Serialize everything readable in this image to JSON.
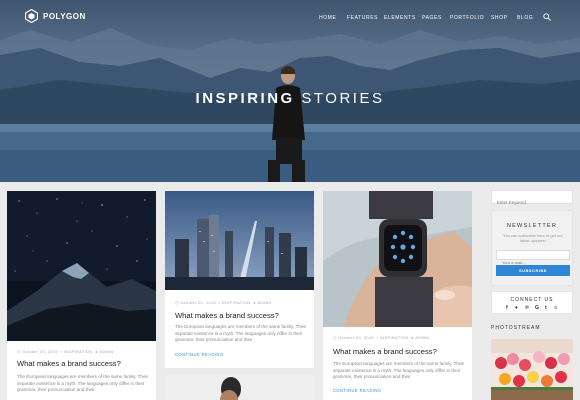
{
  "site": {
    "logo_text": "POLYGON"
  },
  "nav": {
    "items": [
      {
        "label": "HOME",
        "name": "nav-home"
      },
      {
        "label": "FEATURES",
        "name": "nav-features"
      },
      {
        "label": "ELEMENTS",
        "name": "nav-elements"
      },
      {
        "label": "PAGES",
        "name": "nav-pages"
      },
      {
        "label": "PORTFOLIO",
        "name": "nav-portfolio"
      },
      {
        "label": "SHOP",
        "name": "nav-shop"
      },
      {
        "label": "BLOG",
        "name": "nav-blog"
      }
    ],
    "search_icon": "search-icon"
  },
  "hero": {
    "title_bold": "INSPIRING",
    "title_rest": " STORIES"
  },
  "posts": [
    {
      "date": "October 20, 2015",
      "category": "INSPIRATION",
      "author": "ADMIN",
      "title": "What makes a brand success?",
      "excerpt": "The European languages are members of the same family. Their separate existence is a myth. The languages only differ in their grammar, their pronunciation and their",
      "read_more": ""
    },
    {
      "date": "October 20, 2015",
      "category": "INSPIRATION",
      "author": "ADMIN",
      "title": "What makes a brand success?",
      "excerpt": "The European languages are members of the same family. Their separate existence is a myth. The languages only differ in their grammar, their pronunciation and their",
      "read_more": "CONTINUE READING"
    },
    {
      "date": "October 20, 2015",
      "category": "INSPIRATION",
      "author": "ADMIN",
      "title": "What makes a brand success?",
      "excerpt": "The European languages are members of the same family. Their separate existence is a myth. The languages only differ in their grammar, their pronunciation and their",
      "read_more": "CONTINUE READING"
    }
  ],
  "sidebar": {
    "search_placeholder": "Enter Keyword",
    "newsletter": {
      "title": "NEWSLETTER",
      "text": "You can subscribe here to get our latest updates!",
      "email_placeholder": "Your e-mail...",
      "button": "SUBSCRIBE"
    },
    "connect": {
      "title": "CONNECT US",
      "icons": [
        "facebook-icon",
        "twitter-icon",
        "pinterest-icon",
        "google-plus-icon",
        "tumblr-icon",
        "rss-icon"
      ],
      "glyphs": [
        "f",
        "♦",
        "℗",
        "G",
        "t",
        "≡"
      ]
    },
    "photostream": {
      "title": "PHOTOSTREAM"
    }
  },
  "colors": {
    "accent": "#2f86d6",
    "link": "#3b8fd6",
    "background": "#ebebeb"
  }
}
